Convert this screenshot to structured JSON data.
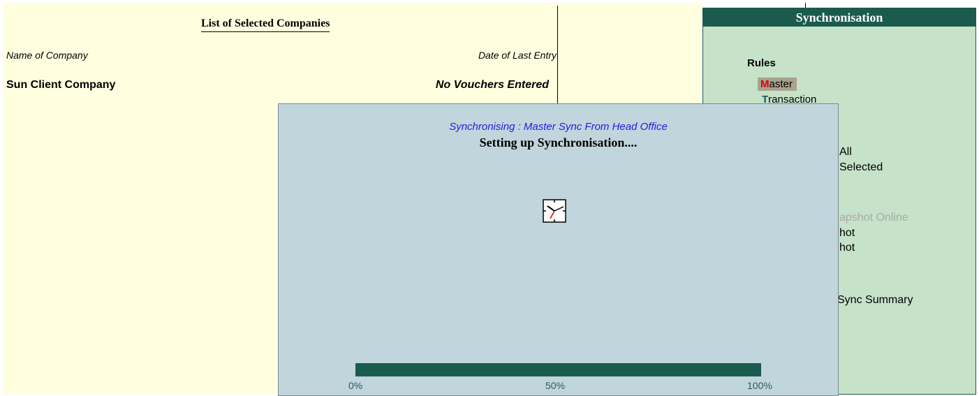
{
  "list": {
    "title": "List of Selected Companies",
    "col_name": "Name of Company",
    "col_date": "Date of Last Entry",
    "rows": [
      {
        "name": "Sun Client Company",
        "date": "No Vouchers Entered"
      }
    ]
  },
  "sync_panel": {
    "title": "Synchronisation",
    "rules_label": "Rules",
    "rules": [
      {
        "hotkey": "M",
        "rest": "aster"
      },
      {
        "hotkey": "T",
        "rest": "ransaction"
      }
    ],
    "partial_texts": [
      "All",
      "Selected",
      "apshot Online",
      "hot",
      "hot",
      "Sync Summary"
    ]
  },
  "dialog": {
    "subtitle": "Synchronising : Master Sync From Head Office",
    "status": "Setting up Synchronisation....",
    "progress_fraction": 1.0,
    "labels": [
      "0%",
      "50%",
      "100%"
    ]
  },
  "colors": {
    "background": "#ffffe0",
    "panel": "#c6e2c9",
    "dialog": "#c0d5dc",
    "accent": "#1b5b4d",
    "subtitle": "#2020e0",
    "hotkey": "#e00000"
  },
  "icons": {
    "clock": "clock-icon"
  }
}
